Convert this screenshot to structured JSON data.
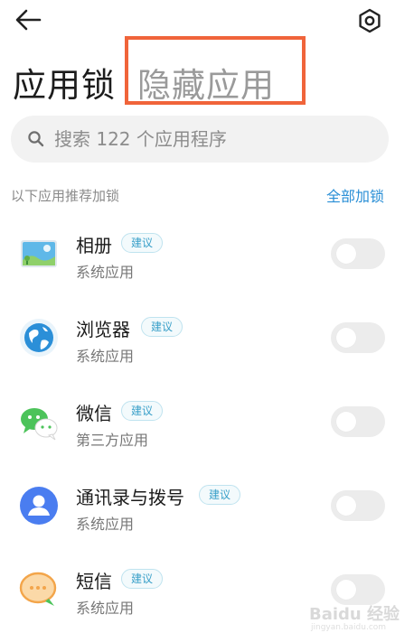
{
  "topbar": {
    "back_icon": "back-arrow-icon",
    "settings_icon": "gear-icon"
  },
  "tabs": [
    {
      "label": "应用锁",
      "active": true
    },
    {
      "label": "隐藏应用",
      "active": false
    }
  ],
  "search": {
    "placeholder": "搜索 122 个应用程序",
    "icon": "search-icon"
  },
  "section": {
    "title": "以下应用推荐加锁",
    "action_label": "全部加锁"
  },
  "apps": [
    {
      "name": "相册",
      "badge": "建议",
      "subtitle": "系统应用",
      "icon": "gallery-icon",
      "locked": false
    },
    {
      "name": "浏览器",
      "badge": "建议",
      "subtitle": "系统应用",
      "icon": "browser-icon",
      "locked": false
    },
    {
      "name": "微信",
      "badge": "建议",
      "subtitle": "第三方应用",
      "icon": "wechat-icon",
      "locked": false
    },
    {
      "name": "通讯录与拨号",
      "badge": "建议",
      "subtitle": "系统应用",
      "icon": "contacts-icon",
      "locked": false
    },
    {
      "name": "短信",
      "badge": "建议",
      "subtitle": "系统应用",
      "icon": "messages-icon",
      "locked": false
    }
  ],
  "watermark": {
    "text": "Baidu 经验",
    "subtext": "jingyan.baidu.com"
  },
  "colors": {
    "highlight": "#f0643a",
    "accent": "#2a8fd6",
    "badge_text": "#3aa0c9",
    "toggle_off": "#ececec"
  }
}
